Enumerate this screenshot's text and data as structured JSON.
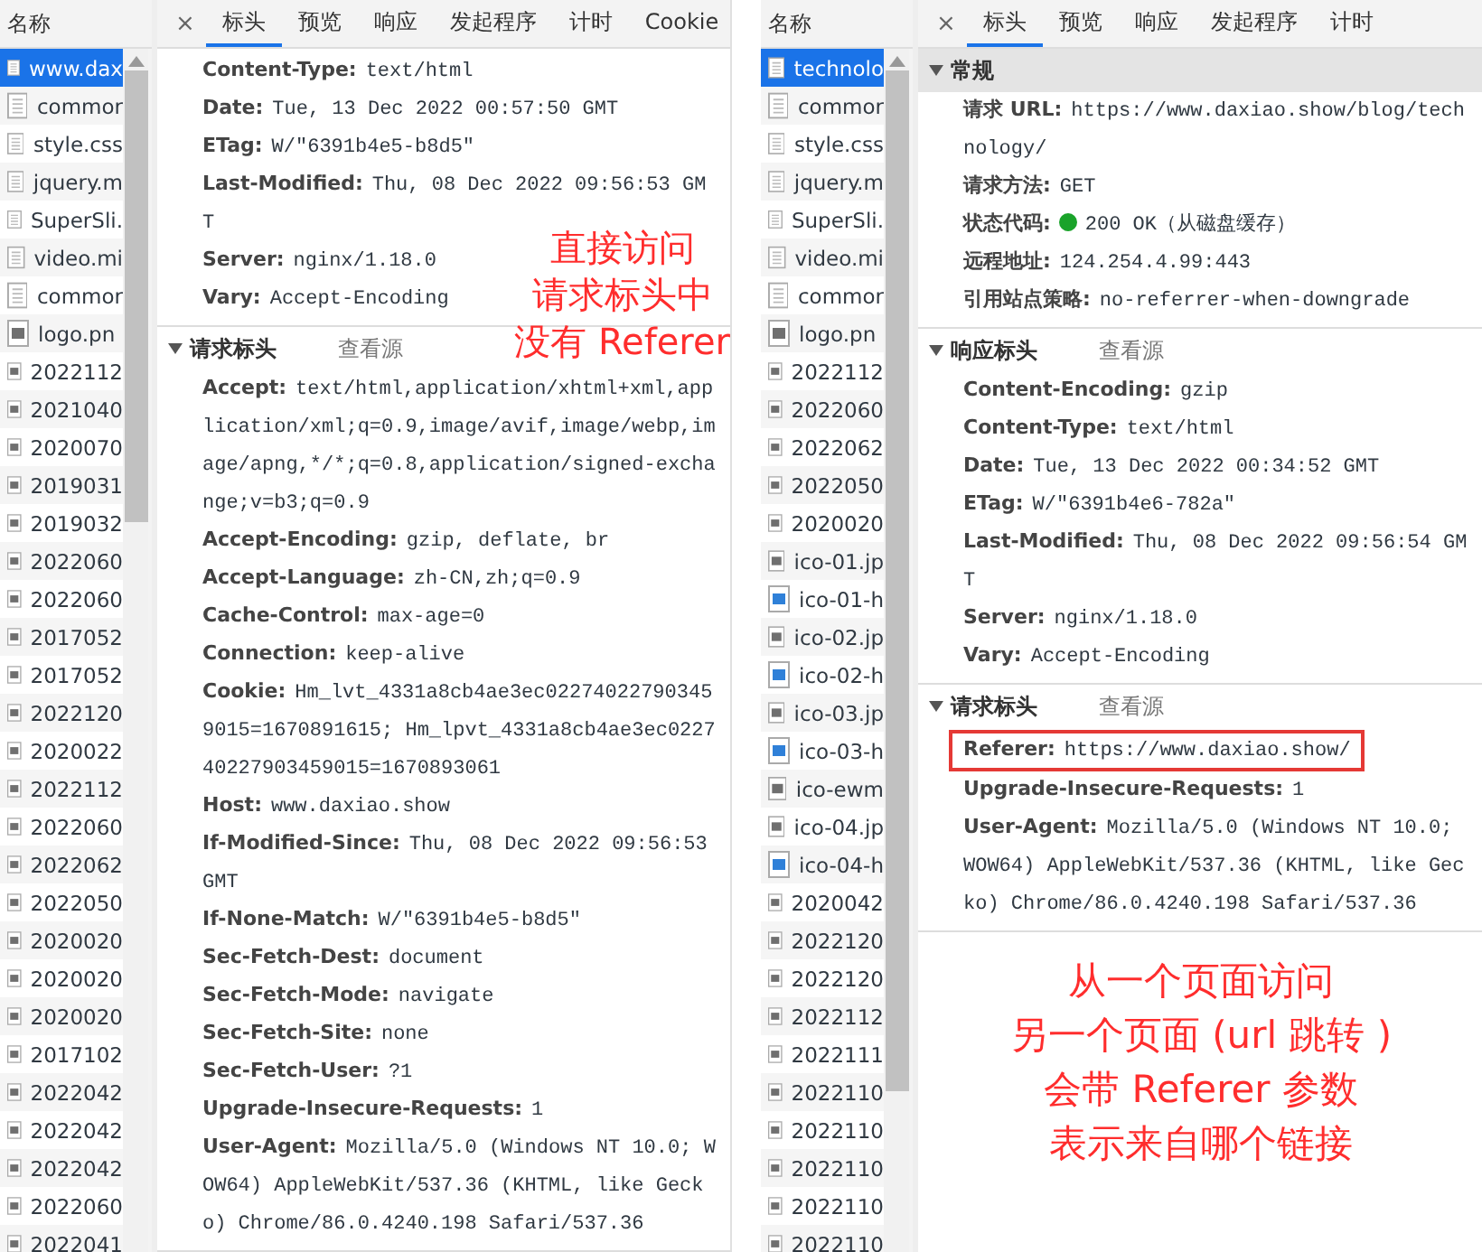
{
  "panels": [
    {
      "list_header": "名称",
      "files": [
        {
          "name": "www.dax",
          "kind": "doc",
          "selected": true
        },
        {
          "name": "commor",
          "kind": "doc",
          "selected": false
        },
        {
          "name": "style.css",
          "kind": "doc",
          "selected": false
        },
        {
          "name": "jquery.m",
          "kind": "doc",
          "selected": false
        },
        {
          "name": "SuperSli.",
          "kind": "doc",
          "selected": false
        },
        {
          "name": "video.mi",
          "kind": "doc",
          "selected": false
        },
        {
          "name": "commor",
          "kind": "doc",
          "selected": false
        },
        {
          "name": "logo.pn",
          "kind": "image",
          "selected": false
        },
        {
          "name": "2022112",
          "kind": "image",
          "selected": false
        },
        {
          "name": "2021040",
          "kind": "image",
          "selected": false
        },
        {
          "name": "2020070",
          "kind": "image",
          "selected": false
        },
        {
          "name": "2019031",
          "kind": "image",
          "selected": false
        },
        {
          "name": "2019032",
          "kind": "image",
          "selected": false
        },
        {
          "name": "2022060",
          "kind": "image",
          "selected": false
        },
        {
          "name": "2022060",
          "kind": "image",
          "selected": false
        },
        {
          "name": "2017052",
          "kind": "image",
          "selected": false
        },
        {
          "name": "2017052",
          "kind": "image",
          "selected": false
        },
        {
          "name": "2022120",
          "kind": "image",
          "selected": false
        },
        {
          "name": "2020022",
          "kind": "image",
          "selected": false
        },
        {
          "name": "2022112",
          "kind": "image",
          "selected": false
        },
        {
          "name": "2022060",
          "kind": "image",
          "selected": false
        },
        {
          "name": "2022062",
          "kind": "image",
          "selected": false
        },
        {
          "name": "2022050",
          "kind": "image",
          "selected": false
        },
        {
          "name": "2020020",
          "kind": "image",
          "selected": false
        },
        {
          "name": "2020020",
          "kind": "image",
          "selected": false
        },
        {
          "name": "2020020",
          "kind": "image",
          "selected": false
        },
        {
          "name": "2017102",
          "kind": "image",
          "selected": false
        },
        {
          "name": "2022042",
          "kind": "image",
          "selected": false
        },
        {
          "name": "2022042",
          "kind": "image",
          "selected": false
        },
        {
          "name": "2022042",
          "kind": "image",
          "selected": false
        },
        {
          "name": "2022060",
          "kind": "image",
          "selected": false
        },
        {
          "name": "2022041",
          "kind": "image",
          "selected": false
        }
      ],
      "close": "×",
      "tabs": [
        {
          "label": "标头",
          "selected": true
        },
        {
          "label": "预览",
          "selected": false
        },
        {
          "label": "响应",
          "selected": false
        },
        {
          "label": "发起程序",
          "selected": false
        },
        {
          "label": "计时",
          "selected": false
        },
        {
          "label": "Cookie",
          "selected": false
        }
      ],
      "sections": [
        {
          "headers": [
            {
              "name": "Content-Type:",
              "value": "text/html",
              "kind": "plain",
              "highlighted": false
            },
            {
              "name": "Date:",
              "value": "Tue, 13 Dec 2022 00:57:50 GMT",
              "kind": "plain",
              "highlighted": false
            },
            {
              "name": "ETag:",
              "value": "W/\"6391b4e5-b8d5\"",
              "kind": "plain",
              "highlighted": false
            },
            {
              "name": "Last-Modified:",
              "value": "Thu, 08 Dec 2022 09:56:53 GMT",
              "kind": "plain",
              "highlighted": false
            },
            {
              "name": "Server:",
              "value": "nginx/1.18.0",
              "kind": "plain",
              "highlighted": false
            },
            {
              "name": "Vary:",
              "value": "Accept-Encoding",
              "kind": "plain",
              "highlighted": false
            }
          ]
        },
        {
          "title": "请求标头",
          "view_source": "查看源",
          "expanded": true,
          "hovered": false,
          "headers": [
            {
              "name": "Accept:",
              "value": "text/html,application/xhtml+xml,application/xml;q=0.9,image/avif,image/webp,image/apng,*/*;q=0.8,application/signed-exchange;v=b3;q=0.9",
              "kind": "plain",
              "highlighted": false
            },
            {
              "name": "Accept-Encoding:",
              "value": "gzip, deflate, br",
              "kind": "plain",
              "highlighted": false
            },
            {
              "name": "Accept-Language:",
              "value": "zh-CN,zh;q=0.9",
              "kind": "plain",
              "highlighted": false
            },
            {
              "name": "Cache-Control:",
              "value": "max-age=0",
              "kind": "plain",
              "highlighted": false
            },
            {
              "name": "Connection:",
              "value": "keep-alive",
              "kind": "plain",
              "highlighted": false
            },
            {
              "name": "Cookie:",
              "value": "Hm_lvt_4331a8cb4ae3ec022740227903459015=1670891615; Hm_lpvt_4331a8cb4ae3ec022740227903459015=1670893061",
              "kind": "plain",
              "highlighted": false
            },
            {
              "name": "Host:",
              "value": "www.daxiao.show",
              "kind": "plain",
              "highlighted": false
            },
            {
              "name": "If-Modified-Since:",
              "value": "Thu, 08 Dec 2022 09:56:53 GMT",
              "kind": "plain",
              "highlighted": false
            },
            {
              "name": "If-None-Match:",
              "value": "W/\"6391b4e5-b8d5\"",
              "kind": "plain",
              "highlighted": false
            },
            {
              "name": "Sec-Fetch-Dest:",
              "value": "document",
              "kind": "plain",
              "highlighted": false
            },
            {
              "name": "Sec-Fetch-Mode:",
              "value": "navigate",
              "kind": "plain",
              "highlighted": false
            },
            {
              "name": "Sec-Fetch-Site:",
              "value": "none",
              "kind": "plain",
              "highlighted": false
            },
            {
              "name": "Sec-Fetch-User:",
              "value": "?1",
              "kind": "plain",
              "highlighted": false
            },
            {
              "name": "Upgrade-Insecure-Requests:",
              "value": "1",
              "kind": "plain",
              "highlighted": false
            },
            {
              "name": "User-Agent:",
              "value": "Mozilla/5.0 (Windows NT 10.0; WOW64) AppleWebKit/537.36 (KHTML, like Gecko) Chrome/86.0.4240.198 Safari/537.36",
              "kind": "plain",
              "highlighted": false
            }
          ]
        }
      ],
      "overlay_annotation": [
        "直接访问",
        "请求标头中",
        "没有 Referer"
      ]
    },
    {
      "list_header": "名称",
      "files": [
        {
          "name": "technolo",
          "kind": "doc",
          "selected": true
        },
        {
          "name": "commor",
          "kind": "doc",
          "selected": false
        },
        {
          "name": "style.css",
          "kind": "doc",
          "selected": false
        },
        {
          "name": "jquery.m",
          "kind": "doc",
          "selected": false
        },
        {
          "name": "SuperSli.",
          "kind": "doc",
          "selected": false
        },
        {
          "name": "video.mi",
          "kind": "doc",
          "selected": false
        },
        {
          "name": "commor",
          "kind": "doc",
          "selected": false
        },
        {
          "name": "logo.pn",
          "kind": "image",
          "selected": false
        },
        {
          "name": "2022112",
          "kind": "image",
          "selected": false
        },
        {
          "name": "2022060",
          "kind": "image",
          "selected": false
        },
        {
          "name": "2022062",
          "kind": "image",
          "selected": false
        },
        {
          "name": "2022050",
          "kind": "image",
          "selected": false
        },
        {
          "name": "2020020",
          "kind": "image",
          "selected": false
        },
        {
          "name": "ico-01.jp",
          "kind": "image",
          "selected": false
        },
        {
          "name": "ico-01-h",
          "kind": "blue",
          "selected": false
        },
        {
          "name": "ico-02.jp",
          "kind": "image",
          "selected": false
        },
        {
          "name": "ico-02-h",
          "kind": "blue",
          "selected": false
        },
        {
          "name": "ico-03.jp",
          "kind": "image",
          "selected": false
        },
        {
          "name": "ico-03-h",
          "kind": "blue",
          "selected": false
        },
        {
          "name": "ico-ewm",
          "kind": "image",
          "selected": false
        },
        {
          "name": "ico-04.jp",
          "kind": "image",
          "selected": false
        },
        {
          "name": "ico-04-h",
          "kind": "blue",
          "selected": false
        },
        {
          "name": "2020042",
          "kind": "image",
          "selected": false
        },
        {
          "name": "2022120",
          "kind": "image",
          "selected": false
        },
        {
          "name": "2022120",
          "kind": "image",
          "selected": false
        },
        {
          "name": "2022112",
          "kind": "image",
          "selected": false
        },
        {
          "name": "2022111",
          "kind": "image",
          "selected": false
        },
        {
          "name": "2022110",
          "kind": "image",
          "selected": false
        },
        {
          "name": "2022110",
          "kind": "image",
          "selected": false
        },
        {
          "name": "2022110",
          "kind": "image",
          "selected": false
        },
        {
          "name": "2022110",
          "kind": "image",
          "selected": false
        },
        {
          "name": "2022110",
          "kind": "image",
          "selected": false
        }
      ],
      "close": "×",
      "tabs": [
        {
          "label": "标头",
          "selected": true
        },
        {
          "label": "预览",
          "selected": false
        },
        {
          "label": "响应",
          "selected": false
        },
        {
          "label": "发起程序",
          "selected": false
        },
        {
          "label": "计时",
          "selected": false
        }
      ],
      "sections": [
        {
          "title": "常规",
          "expanded": true,
          "hovered": true,
          "headers": [
            {
              "name": "请求 URL:",
              "value": "https://www.daxiao.show/blog/technology/",
              "kind": "plain",
              "highlighted": false
            },
            {
              "name": "请求方法:",
              "value": "GET",
              "kind": "plain",
              "highlighted": false
            },
            {
              "name": "状态代码:",
              "value": "200 OK（从磁盘缓存）",
              "kind": "status",
              "highlighted": false
            },
            {
              "name": "远程地址:",
              "value": "124.254.4.99:443",
              "kind": "plain",
              "highlighted": false
            },
            {
              "name": "引用站点策略:",
              "value": "no-referrer-when-downgrade",
              "kind": "plain",
              "highlighted": false
            }
          ]
        },
        {
          "title": "响应标头",
          "view_source": "查看源",
          "expanded": true,
          "hovered": false,
          "headers": [
            {
              "name": "Content-Encoding:",
              "value": "gzip",
              "kind": "plain",
              "highlighted": false
            },
            {
              "name": "Content-Type:",
              "value": "text/html",
              "kind": "plain",
              "highlighted": false
            },
            {
              "name": "Date:",
              "value": "Tue, 13 Dec 2022 00:34:52 GMT",
              "kind": "plain",
              "highlighted": false
            },
            {
              "name": "ETag:",
              "value": "W/\"6391b4e6-782a\"",
              "kind": "plain",
              "highlighted": false
            },
            {
              "name": "Last-Modified:",
              "value": "Thu, 08 Dec 2022 09:56:54 GMT",
              "kind": "plain",
              "highlighted": false
            },
            {
              "name": "Server:",
              "value": "nginx/1.18.0",
              "kind": "plain",
              "highlighted": false
            },
            {
              "name": "Vary:",
              "value": "Accept-Encoding",
              "kind": "plain",
              "highlighted": false
            }
          ]
        },
        {
          "title": "请求标头",
          "view_source": "查看源",
          "expanded": true,
          "hovered": false,
          "headers": [
            {
              "name": "Referer:",
              "value": "https://www.daxiao.show/",
              "kind": "plain",
              "highlighted": true
            },
            {
              "name": "Upgrade-Insecure-Requests:",
              "value": "1",
              "kind": "plain",
              "highlighted": false
            },
            {
              "name": "User-Agent:",
              "value": "Mozilla/5.0 (Windows NT 10.0; WOW64) AppleWebKit/537.36 (KHTML, like Gecko) Chrome/86.0.4240.198 Safari/537.36",
              "kind": "plain",
              "highlighted": false
            }
          ]
        }
      ],
      "annotation": [
        "从一个页面访问",
        "另一个页面 (url 跳转 )",
        "会带 Referer 参数",
        "表示来自哪个链接"
      ]
    }
  ]
}
